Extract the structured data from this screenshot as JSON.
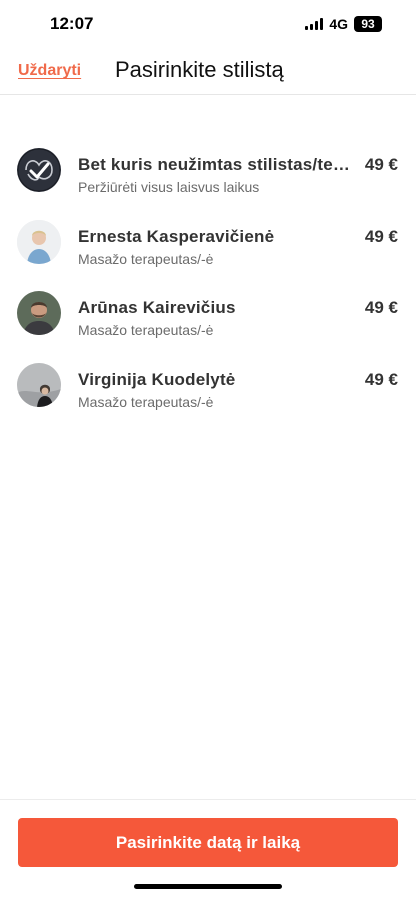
{
  "status_bar": {
    "time": "12:07",
    "network": "4G",
    "battery": "93"
  },
  "header": {
    "close_label": "Uždaryti",
    "title": "Pasirinkite stilistą"
  },
  "stylists": [
    {
      "name": "Bet kuris neužimtas stilistas/terapeutas",
      "subtitle": "Peržiūrėti visus laisvus laikus",
      "price": "49 €",
      "avatar": "any-stylist-icon"
    },
    {
      "name": "Ernesta  Kasperavičienė",
      "subtitle": "Masažo terapeutas/-ė",
      "price": "49 €",
      "avatar": "avatar-photo"
    },
    {
      "name": "Arūnas Kairevičius",
      "subtitle": "Masažo terapeutas/-ė",
      "price": "49 €",
      "avatar": "avatar-photo"
    },
    {
      "name": "Virginija Kuodelytė",
      "subtitle": "Masažo terapeutas/-ė",
      "price": "49 €",
      "avatar": "avatar-photo"
    }
  ],
  "footer": {
    "button_label": "Pasirinkite datą ir laiką"
  },
  "colors": {
    "accent": "#f5583a",
    "close_link": "#f06a4a"
  }
}
